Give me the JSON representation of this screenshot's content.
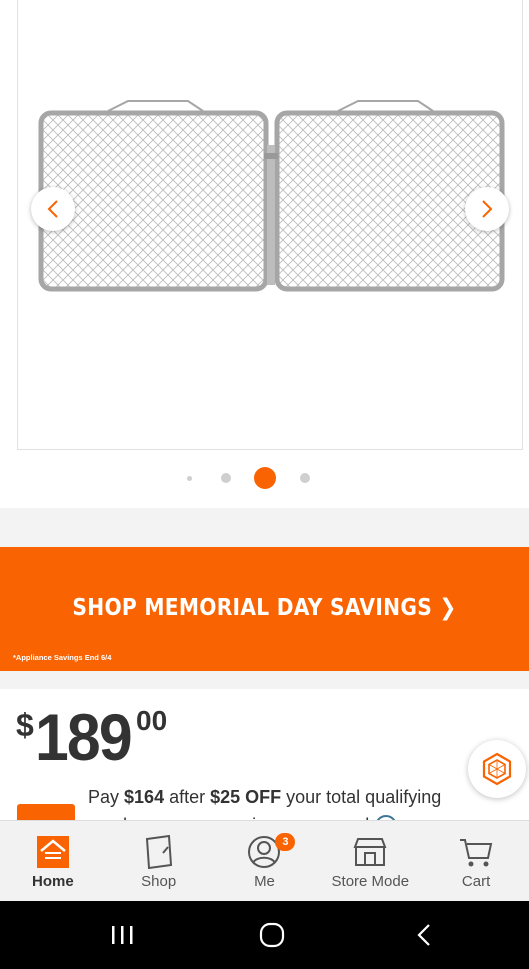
{
  "carousel": {
    "image_alt": "Double chain link fence gate",
    "prev_icon": "chevron-left-icon",
    "next_icon": "chevron-right-icon",
    "slide_count": 4,
    "active_slide": 3
  },
  "promo": {
    "title": "SHOP MEMORIAL DAY SAVINGS ❯",
    "note": "*Appliance Savings End 6/4"
  },
  "price": {
    "currency": "$",
    "dollars": "189",
    "cents": "00"
  },
  "credit_offer": {
    "pay_prefix": "Pay ",
    "pay_amount": "$164",
    "after_text": " after ",
    "off_amount": "$25 OFF",
    "rest_text": " your total qualifying purchase upon opening a new card",
    "info_icon": "i"
  },
  "nav": {
    "items": [
      {
        "label": "Home",
        "icon": "home-depot-logo-icon",
        "active": true
      },
      {
        "label": "Shop",
        "icon": "shop-icon"
      },
      {
        "label": "Me",
        "icon": "profile-icon",
        "badge": "3"
      },
      {
        "label": "Store Mode",
        "icon": "store-icon"
      },
      {
        "label": "Cart",
        "icon": "cart-icon"
      }
    ]
  },
  "colors": {
    "brand_orange": "#f96302",
    "text_dark": "#333333",
    "info_blue": "#3e7697"
  }
}
